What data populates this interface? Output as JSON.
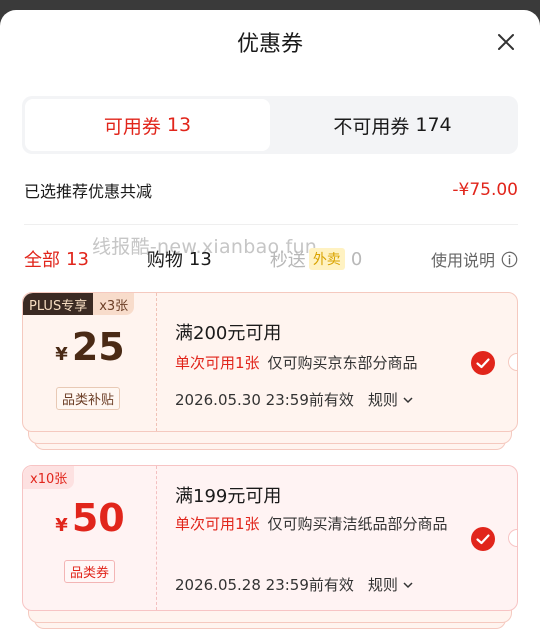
{
  "header": {
    "title": "优惠券"
  },
  "tabs": [
    {
      "label": "可用券",
      "count": "13"
    },
    {
      "label": "不可用券",
      "count": "174"
    }
  ],
  "summary": {
    "label": "已选推荐优惠共减",
    "value": "-¥75.00"
  },
  "watermark": "线报酷-new.xianbao.fun",
  "filters": {
    "all": {
      "label": "全部",
      "count": "13"
    },
    "shopping": {
      "label": "购物",
      "count": "13"
    },
    "miaosong": {
      "label": "秒送",
      "tag": "外卖",
      "count": "0"
    },
    "help": "使用说明"
  },
  "coupons": [
    {
      "plus_label": "PLUS专享",
      "qty": "x3张",
      "currency": "¥",
      "amount": "25",
      "tag": "品类补贴",
      "condition": "满200元可用",
      "once": "单次可用1张",
      "scope": "仅可购买京东部分商品",
      "valid": "2026.05.30 23:59前有效",
      "rule": "规则"
    },
    {
      "qty": "x10张",
      "currency": "¥",
      "amount": "50",
      "tag": "品类券",
      "condition": "满199元可用",
      "once": "单次可用1张",
      "scope": "仅可购买清洁纸品部分商品",
      "valid": "2026.05.28 23:59前有效",
      "rule": "规则"
    }
  ],
  "colors": {
    "accent": "#e1251b",
    "coupon_brown": "#4a2a15"
  }
}
